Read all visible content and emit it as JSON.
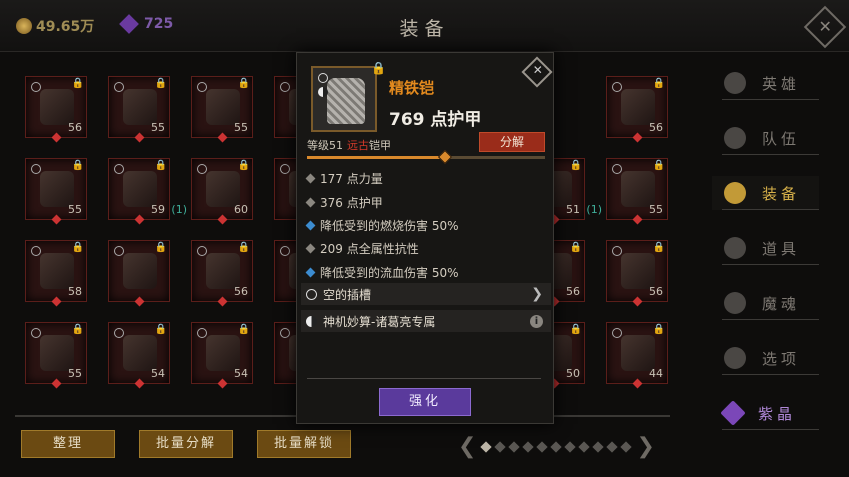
{
  "header": {
    "title": "装备",
    "gold": "49.65万",
    "gems": "725"
  },
  "grid": {
    "slots": [
      {
        "lvl": "56"
      },
      {
        "lvl": "55"
      },
      {
        "lvl": "55"
      },
      {
        "lvl": ""
      },
      {
        "lvl": "56"
      },
      {
        "lvl": "55"
      },
      {
        "lvl": "59",
        "extra": "(1)"
      },
      {
        "lvl": "60"
      },
      {
        "lvl": ""
      },
      {
        "lvl": "51",
        "extra": "(1)"
      },
      {
        "lvl": "55"
      },
      {
        "lvl": "58"
      },
      {
        "lvl": ""
      },
      {
        "lvl": "56"
      },
      {
        "lvl": ""
      },
      {
        "lvl": "56"
      },
      {
        "lvl": "56"
      },
      {
        "lvl": "55"
      },
      {
        "lvl": "54"
      },
      {
        "lvl": "54"
      },
      {
        "lvl": ""
      },
      {
        "lvl": "50"
      },
      {
        "lvl": "44"
      }
    ]
  },
  "bottom": {
    "sort": "整理",
    "batch_decompose": "批量分解",
    "batch_unlock": "批量解锁",
    "page_left": "❮",
    "page_right": "❯"
  },
  "nav": {
    "items": [
      {
        "label": "英雄",
        "icon": "heroes-icon"
      },
      {
        "label": "队伍",
        "icon": "flag-icon"
      },
      {
        "label": "装备",
        "icon": "helmet-icon"
      },
      {
        "label": "道具",
        "icon": "bag-icon"
      },
      {
        "label": "魔魂",
        "icon": "flame-icon"
      },
      {
        "label": "选项",
        "icon": "gear-icon"
      },
      {
        "label": "紫晶",
        "icon": "amethyst-icon"
      }
    ]
  },
  "popup": {
    "name": "精铁铠",
    "armor": "769 点护甲",
    "level": "等级51",
    "rarity": "远古",
    "type": "铠甲",
    "decompose": "分解",
    "progress": 0.58,
    "stats": [
      {
        "text": "177 点力量",
        "blue": false
      },
      {
        "text": "376 点护甲",
        "blue": false
      },
      {
        "text": "降低受到的燃烧伤害 50%",
        "blue": true
      },
      {
        "text": "209 点全属性抗性",
        "blue": false
      },
      {
        "text": "降低受到的流血伤害 50%",
        "blue": true
      }
    ],
    "socket": "空的插槽",
    "set": "神机妙算-诸葛亮专属",
    "info_glyph": "i",
    "enhance": "强化",
    "close_glyph": "✕"
  },
  "colors": {
    "accent_gold": "#d7b14a",
    "item_orange": "#e38a1e",
    "ancient_red": "#d43a2a",
    "enhance_purple": "#5a3a9c"
  }
}
